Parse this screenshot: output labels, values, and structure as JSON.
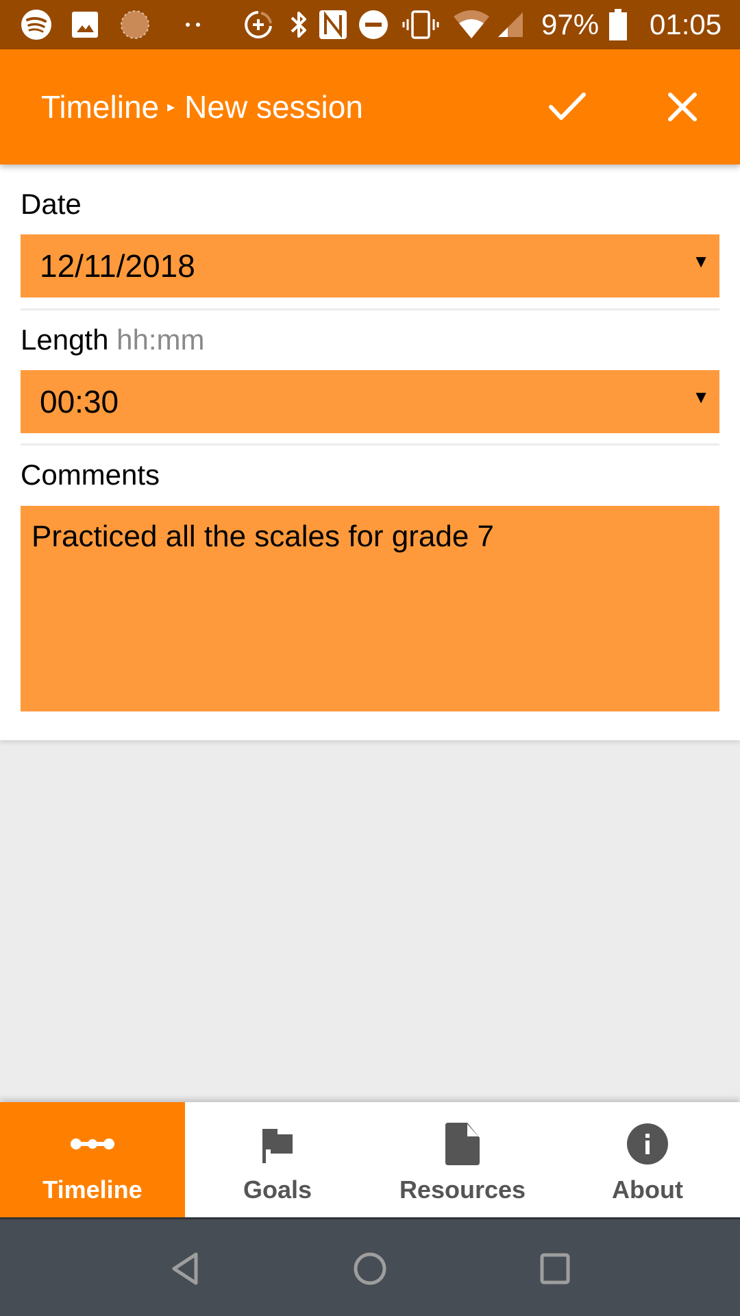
{
  "status_bar": {
    "icons": [
      "spotify-icon",
      "image-icon",
      "sync-icon",
      "more-dots-icon",
      "data-saver-icon",
      "bluetooth-icon",
      "nfc-icon",
      "do-not-disturb-icon",
      "vibrate-icon",
      "wifi-icon",
      "cell-signal-icon",
      "battery-icon"
    ],
    "battery": "97%",
    "time": "01:05"
  },
  "app_bar": {
    "breadcrumb_parent": "Timeline",
    "breadcrumb_separator": "▸",
    "title": "New session",
    "confirm_icon": "check-icon",
    "close_icon": "close-icon"
  },
  "form": {
    "date": {
      "label": "Date",
      "value": "12/11/2018"
    },
    "length": {
      "label": "Length",
      "hint": "hh:mm",
      "value": "00:30"
    },
    "comments": {
      "label": "Comments",
      "value": "Practiced all the scales for grade 7"
    },
    "caret": "▼"
  },
  "bottom_nav": {
    "items": [
      {
        "label": "Timeline",
        "icon": "timeline-icon",
        "active": true
      },
      {
        "label": "Goals",
        "icon": "flag-icon",
        "active": false
      },
      {
        "label": "Resources",
        "icon": "document-icon",
        "active": false
      },
      {
        "label": "About",
        "icon": "info-icon",
        "active": false
      }
    ]
  },
  "system_nav": {
    "back": "back-icon",
    "home": "home-icon",
    "recents": "recents-icon"
  },
  "colors": {
    "accent": "#ff8000",
    "field": "#ff9a3c",
    "status_bar": "#974900",
    "system_nav": "#464d54"
  }
}
